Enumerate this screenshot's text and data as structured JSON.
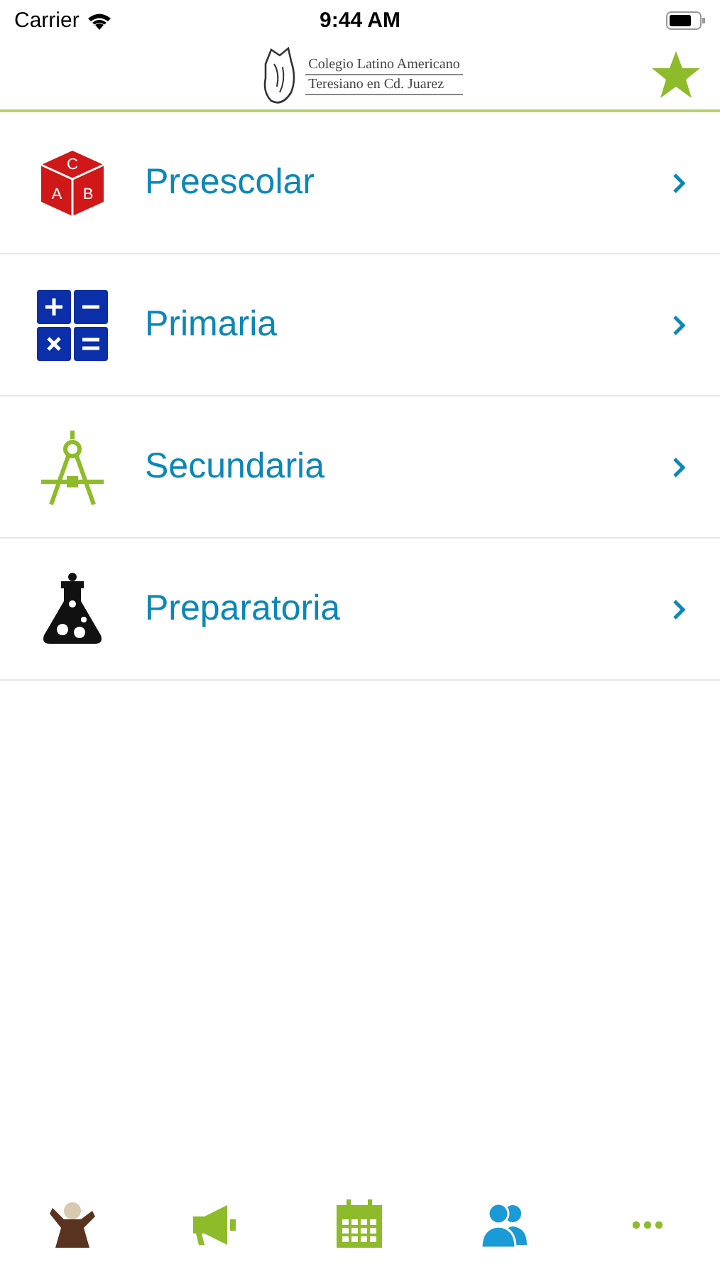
{
  "status_bar": {
    "carrier": "Carrier",
    "time": "9:44 AM"
  },
  "header": {
    "logo_lines": [
      "Colegio Latino Americano",
      "Teresiano en Cd. Juarez"
    ]
  },
  "menu": [
    {
      "label": "Preescolar",
      "kind": "block",
      "letters": [
        "A",
        "B",
        "C"
      ]
    },
    {
      "label": "Primaria",
      "kind": "math"
    },
    {
      "label": "Secundaria",
      "kind": "compass"
    },
    {
      "label": "Preparatoria",
      "kind": "flask"
    }
  ],
  "tab_bar": [
    {
      "kind": "figure",
      "selected": false
    },
    {
      "kind": "megaphone",
      "selected": false
    },
    {
      "kind": "calendar",
      "selected": false
    },
    {
      "kind": "people",
      "selected": true
    },
    {
      "kind": "more",
      "selected": false
    }
  ]
}
